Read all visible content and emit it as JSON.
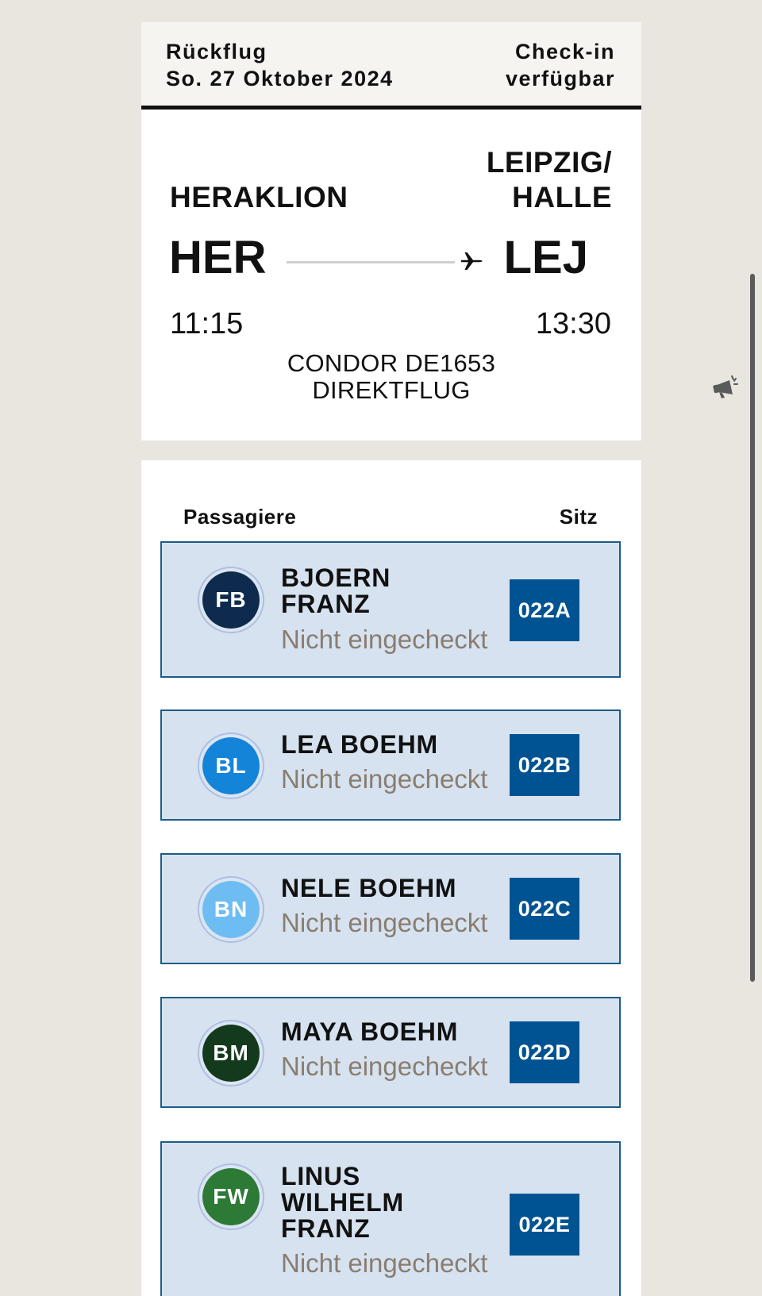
{
  "flight": {
    "header_left_line1": "Rückflug",
    "header_left_line2": "So. 27 Oktober 2024",
    "header_right_line1": "Check-in",
    "header_right_line2": "verfügbar",
    "origin_city": "HERAKLION",
    "destination_city_line1": "LEIPZIG/",
    "destination_city_line2": "HALLE",
    "origin_code": "HER",
    "destination_code": "LEJ",
    "departure_time": "11:15",
    "arrival_time": "13:30",
    "flight_number": "CONDOR DE1653",
    "flight_type": "DIREKTFLUG"
  },
  "passengers_header": {
    "label": "Passagiere",
    "seat_label": "Sitz"
  },
  "passengers": [
    {
      "initials": "FB",
      "name_lines": [
        "BJOERN",
        "FRANZ"
      ],
      "status": "Nicht eingecheckt",
      "seat": "022A",
      "color": "#0e2b4d"
    },
    {
      "initials": "BL",
      "name_lines": [
        "LEA BOEHM"
      ],
      "status": "Nicht eingecheckt",
      "seat": "022B",
      "color": "#1484d9"
    },
    {
      "initials": "BN",
      "name_lines": [
        "NELE BOEHM"
      ],
      "status": "Nicht eingecheckt",
      "seat": "022C",
      "color": "#6ebdf2"
    },
    {
      "initials": "BM",
      "name_lines": [
        "MAYA BOEHM"
      ],
      "status": "Nicht eingecheckt",
      "seat": "022D",
      "color": "#143a1e"
    },
    {
      "initials": "FW",
      "name_lines": [
        "LINUS",
        "WILHELM",
        "FRANZ"
      ],
      "status": "Nicht eingecheckt",
      "seat": "022E",
      "color": "#2c7a36"
    }
  ],
  "colors": {
    "background": "#e8e6df",
    "passenger_card_bg": "#d6e2ef",
    "passenger_card_border": "#1a5c86",
    "seat_badge": "#005392",
    "status_text": "#8a7d70"
  },
  "icons": {
    "route_icon": "airplane-icon",
    "side_icon": "megaphone-icon"
  }
}
